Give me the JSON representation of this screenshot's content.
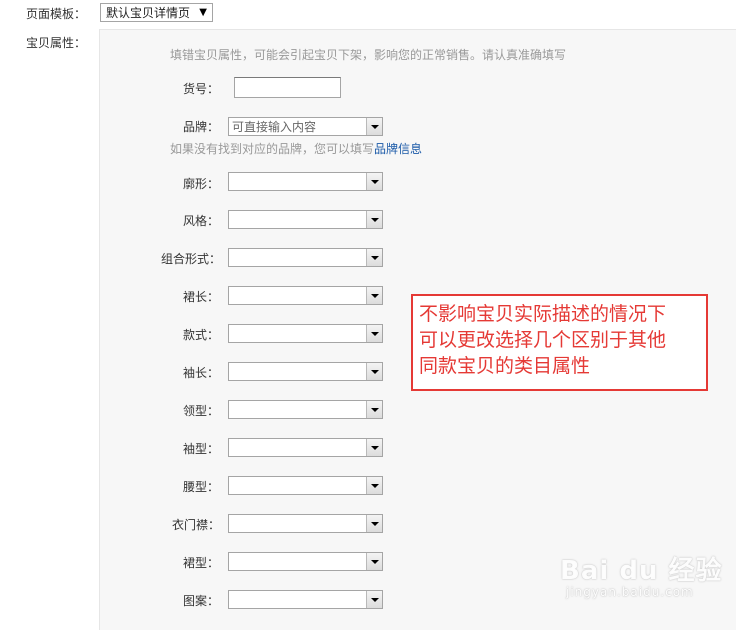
{
  "template": {
    "label": "页面模板：",
    "selected": "默认宝贝详情页"
  },
  "attributes": {
    "label": "宝贝属性：",
    "hint": "填错宝贝属性，可能会引起宝贝下架，影响您的正常销售。请认真准确填写",
    "item_no": {
      "label": "货号：",
      "value": ""
    },
    "brand": {
      "label": "品牌：",
      "placeholder": "可直接输入内容",
      "hint": "如果没有找到对应的品牌，您可以填写",
      "link": "品牌信息"
    },
    "fields": [
      {
        "label": "廓形：",
        "value": ""
      },
      {
        "label": "风格：",
        "value": ""
      },
      {
        "label": "组合形式：",
        "value": ""
      },
      {
        "label": "裙长：",
        "value": ""
      },
      {
        "label": "款式：",
        "value": ""
      },
      {
        "label": "袖长：",
        "value": ""
      },
      {
        "label": "领型：",
        "value": ""
      },
      {
        "label": "袖型：",
        "value": ""
      },
      {
        "label": "腰型：",
        "value": ""
      },
      {
        "label": "衣门襟：",
        "value": ""
      },
      {
        "label": "裙型：",
        "value": ""
      },
      {
        "label": "图案：",
        "value": ""
      }
    ]
  },
  "annotation": {
    "lines": [
      "不影响宝贝实际描述的情况下",
      "可以更改选择几个区别于其他",
      "同款宝贝的类目属性"
    ],
    "color": "#e53935"
  },
  "watermark": {
    "logo": "Bai du 经验",
    "site": "jingyan.baidu.com"
  }
}
